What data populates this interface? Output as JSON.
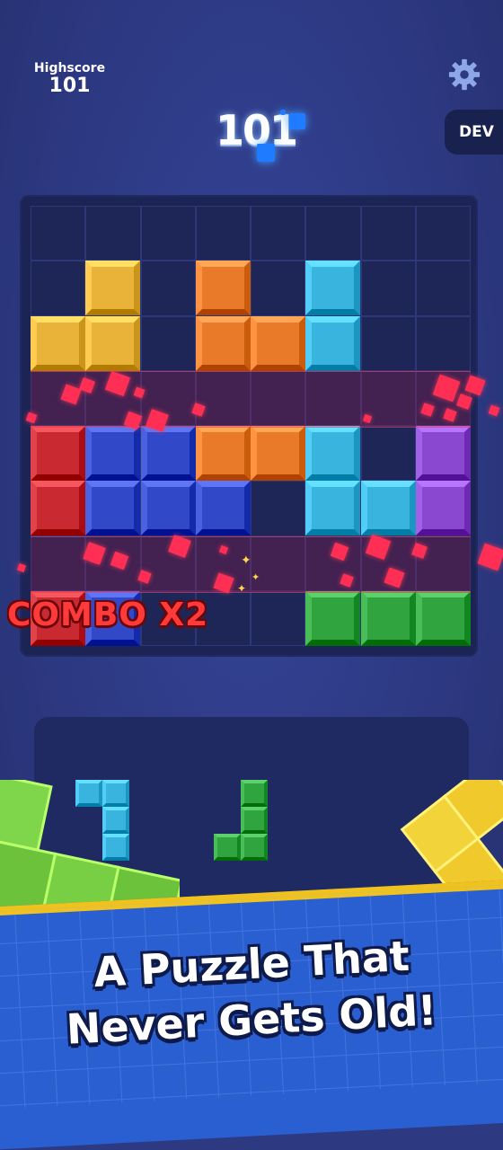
{
  "header": {
    "highscore_label": "Highscore",
    "highscore_value": "101",
    "score": "101",
    "dev_label": "DEV",
    "settings_icon": "gear-icon"
  },
  "colors": {
    "yellow": "#e8b338",
    "orange": "#e87a2a",
    "cyan": "#38b4df",
    "red": "#c92a32",
    "blue": "#3148c9",
    "purple": "#8a48d1",
    "green": "#2fa43f",
    "empty": "#1e2658"
  },
  "board": {
    "rows": [
      [
        null,
        null,
        null,
        null,
        null,
        null,
        null,
        null
      ],
      [
        null,
        "yellow",
        null,
        "orange",
        null,
        "cyan",
        null,
        null
      ],
      [
        "yellow",
        "yellow",
        null,
        "orange",
        "orange",
        "cyan",
        null,
        null
      ],
      [
        null,
        null,
        null,
        null,
        null,
        null,
        null,
        null
      ],
      [
        "red",
        "blue",
        "blue",
        "orange",
        "orange",
        "cyan",
        null,
        "purple"
      ],
      [
        "red",
        "blue",
        "blue",
        "blue",
        null,
        "cyan",
        "cyan",
        "purple"
      ],
      [
        null,
        null,
        null,
        null,
        null,
        null,
        null,
        null
      ],
      [
        "red",
        "blue",
        null,
        null,
        null,
        "green",
        "green",
        "green"
      ]
    ],
    "cleared_rows": [
      3,
      6
    ]
  },
  "combo_text": "COMBO X2",
  "pieces": [
    {
      "color": "cyan",
      "cells": [
        [
          0,
          0
        ],
        [
          0,
          1
        ],
        [
          1,
          1
        ],
        [
          2,
          1
        ]
      ]
    },
    {
      "color": "green",
      "cells": [
        [
          0,
          1
        ],
        [
          1,
          1
        ],
        [
          2,
          0
        ],
        [
          2,
          1
        ]
      ]
    }
  ],
  "tagline": {
    "line1": "A Puzzle That",
    "line2": "Never Gets Old!"
  }
}
